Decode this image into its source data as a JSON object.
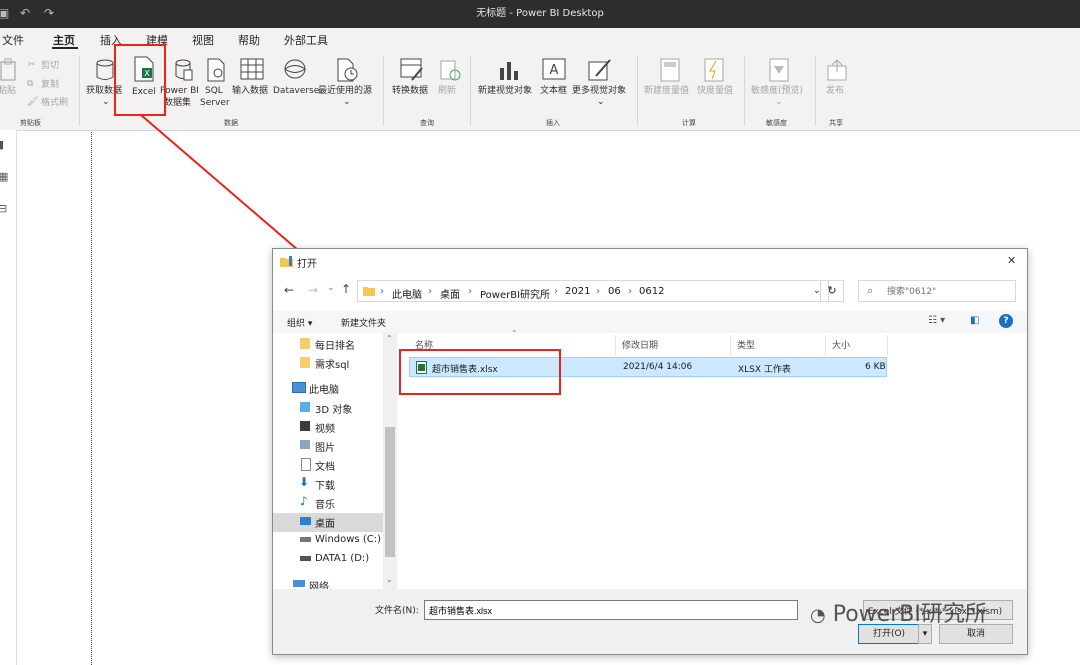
{
  "app": {
    "window_title": "无标题 - Power BI Desktop"
  },
  "menu": {
    "items": [
      "文件",
      "主页",
      "插入",
      "建模",
      "视图",
      "帮助",
      "外部工具"
    ],
    "active": "主页"
  },
  "ribbon": {
    "clipboard": {
      "paste": "粘贴",
      "cut": "剪切",
      "copy": "复制",
      "format_painter": "格式刷",
      "group": "剪贴板"
    },
    "data": {
      "get_data": "获取数据",
      "excel": "Excel",
      "pbi_dataset_1": "Power BI",
      "pbi_dataset_2": "数据集",
      "sql_1": "SQL",
      "sql_2": "Server",
      "enter_data": "输入数据",
      "dataverse": "Dataverse",
      "recent": "最近使用的源",
      "group": "数据"
    },
    "query": {
      "transform": "转换数据",
      "refresh": "刷新",
      "group": "查询"
    },
    "insert": {
      "new_visual": "新建视觉对象",
      "text_box": "文本框",
      "more_visuals": "更多视觉对象",
      "group": "插入"
    },
    "calc": {
      "new_measure": "新建度量值",
      "quick_measure": "快度量值",
      "group": "计算"
    },
    "sensitivity": {
      "label": "敏感度(预览)",
      "group": "敏感度"
    },
    "share": {
      "publish": "发布",
      "group": "共享"
    }
  },
  "dialog": {
    "title": "打开",
    "close": "✕",
    "breadcrumbs": [
      "此电脑",
      "桌面",
      "PowerBI研究所",
      "2021",
      "06",
      "0612"
    ],
    "search_placeholder": "搜索\"0612\"",
    "toolbar": {
      "organize": "组织 ▾",
      "new_folder": "新建文件夹"
    },
    "nav": [
      {
        "label": "每日排名",
        "icon": "folder-icon"
      },
      {
        "label": "需求sql",
        "icon": "folder-icon"
      },
      {
        "label": "此电脑",
        "icon": "computer-icon"
      },
      {
        "label": "3D 对象",
        "icon": "cube-icon"
      },
      {
        "label": "视频",
        "icon": "video-icon"
      },
      {
        "label": "图片",
        "icon": "picture-icon"
      },
      {
        "label": "文档",
        "icon": "document-icon"
      },
      {
        "label": "下载",
        "icon": "download-icon"
      },
      {
        "label": "音乐",
        "icon": "music-icon"
      },
      {
        "label": "桌面",
        "icon": "desktop-icon"
      },
      {
        "label": "Windows (C:)",
        "icon": "drive-icon"
      },
      {
        "label": "DATA1 (D:)",
        "icon": "drive-icon"
      },
      {
        "label": "网络",
        "icon": "network-icon"
      }
    ],
    "columns": [
      "名称",
      "修改日期",
      "类型",
      "大小"
    ],
    "files": [
      {
        "name": "超市销售表.xlsx",
        "modified": "2021/6/4 14:06",
        "type": "XLSX 工作表",
        "size": "6 KB"
      }
    ],
    "filename_label": "文件名(N):",
    "filename_value": "超市销售表.xlsx",
    "filetype_value": "Excel 文件 (*.xl*;*.xlsx;*.xlsm)",
    "open_button": "打开(O)",
    "cancel_button": "取消"
  },
  "watermark": "PowerBI研究所",
  "colors": {
    "accent_red": "#e8241c",
    "selection": "#cce8ff",
    "titlebar": "#2d2d2d"
  }
}
